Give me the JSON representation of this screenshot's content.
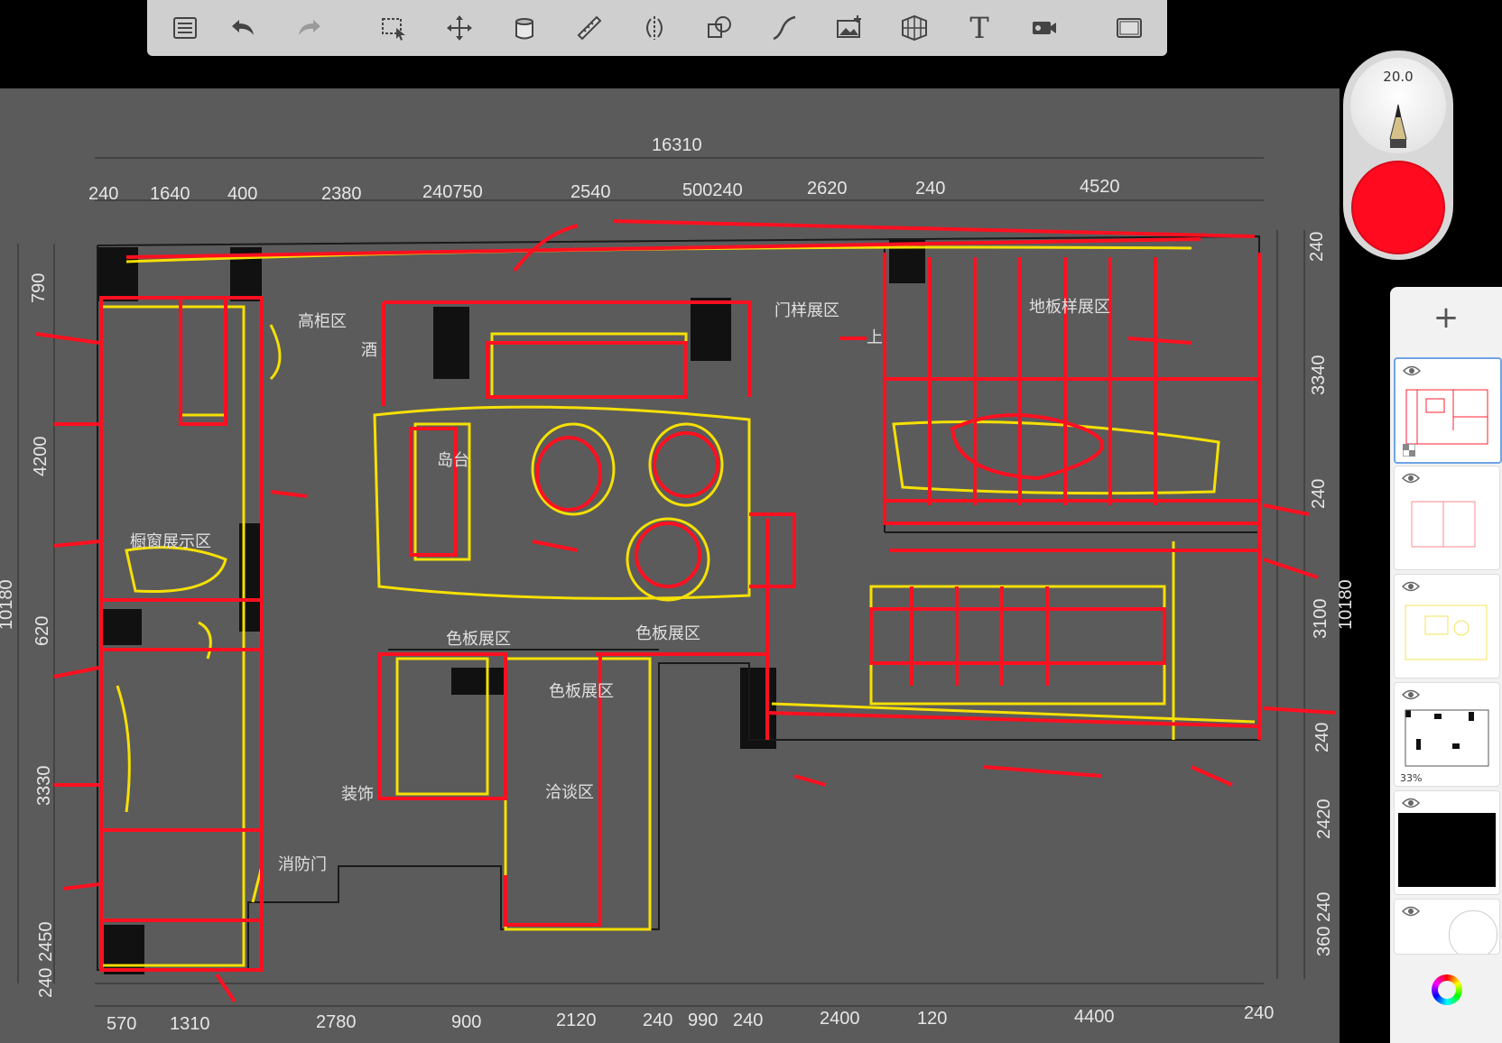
{
  "toolbar": {
    "tools": [
      {
        "name": "layers-list-icon"
      },
      {
        "name": "undo-icon"
      },
      {
        "name": "redo-icon"
      },
      {
        "name": "selection-icon"
      },
      {
        "name": "transform-icon"
      },
      {
        "name": "fill-bucket-icon"
      },
      {
        "name": "ruler-icon"
      },
      {
        "name": "symmetry-icon"
      },
      {
        "name": "shape-icon"
      },
      {
        "name": "stroke-icon"
      },
      {
        "name": "add-image-icon"
      },
      {
        "name": "perspective-grid-icon"
      },
      {
        "name": "text-icon"
      },
      {
        "name": "video-icon"
      },
      {
        "name": "fullscreen-icon"
      }
    ],
    "text_tool_label": "T"
  },
  "brush": {
    "size": "20.0",
    "color": "#ff0a1e"
  },
  "layers": {
    "add_label": "+",
    "opacity_label": "33%"
  },
  "plan": {
    "top_total": "16310",
    "top_dims": [
      "240",
      "1640",
      "400",
      "2380",
      "240750",
      "2540",
      "500240",
      "2620",
      "240",
      "4520"
    ],
    "bottom_dims": [
      "570",
      "1310",
      "2780",
      "900",
      "2120",
      "240",
      "990",
      "240",
      "2400",
      "120",
      "4400",
      "240"
    ],
    "left_dims": [
      "790",
      "4200",
      "10180",
      "620",
      "3330",
      "2450",
      "240"
    ],
    "right_dims": [
      "240",
      "3340",
      "240",
      "10180",
      "3100",
      "240",
      "2420",
      "240",
      "360"
    ],
    "rooms": [
      "高柜区",
      "酒",
      "门样展区",
      "地板样展区",
      "上",
      "橱窗展示区",
      "岛台",
      "色板展区",
      "色板展区",
      "色板展区",
      "装饰",
      "洽谈区",
      "消防门"
    ]
  }
}
